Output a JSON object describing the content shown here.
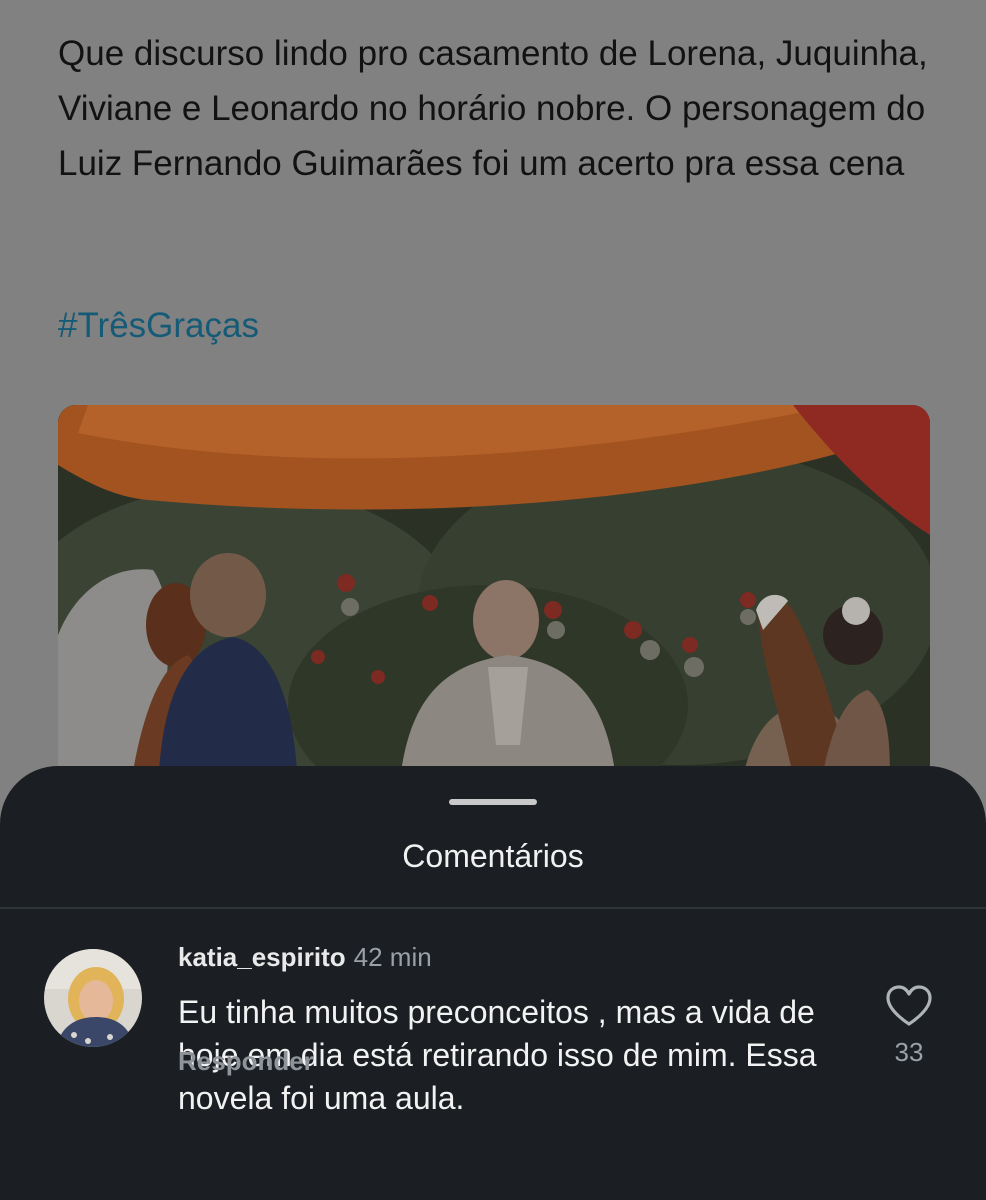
{
  "post": {
    "text": "Que discurso lindo pro casamento de Lorena, Juquinha, Viviane e Leonardo no horário nobre. O personagem do Luiz Fernando Guimarães foi um acerto pra essa cena",
    "hashtag": "#TrêsGraças"
  },
  "sheet": {
    "title": "Comentários"
  },
  "comments": [
    {
      "username": "katia_espirito",
      "time": "42 min",
      "text": "Eu tinha muitos preconceitos , mas a vida de hoje em dia está retirando isso de mim. Essa novela foi uma aula.",
      "reply_label": "Responder",
      "likes": "33",
      "like_icon": "heart-outline-icon"
    }
  ],
  "colors": {
    "sheet_bg": "#1b1f23",
    "hashtag": "#155a77",
    "overlay_bg": "#818181"
  }
}
